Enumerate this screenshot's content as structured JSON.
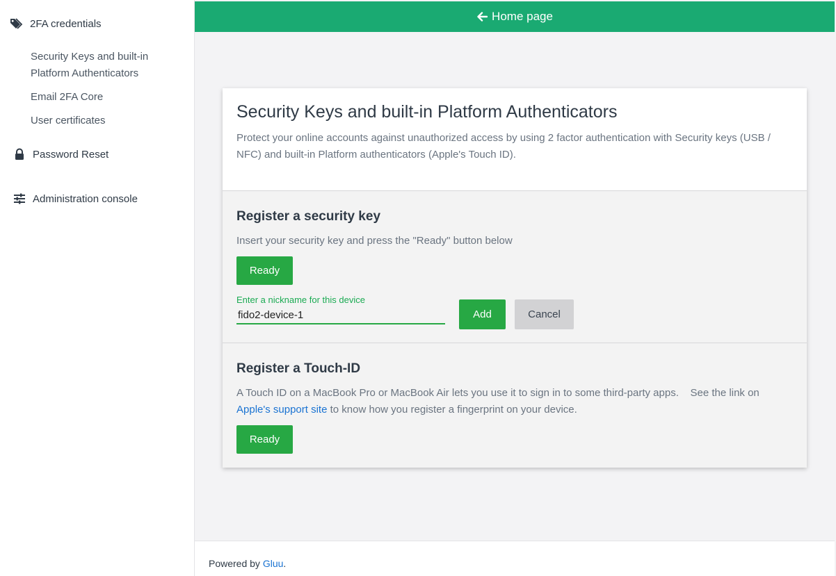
{
  "sidebar": {
    "heading": {
      "label": "2FA credentials",
      "icon": "tags-icon"
    },
    "sub_items": [
      {
        "label_line1": "Security Keys and built-in",
        "label_line2": "Platform Authenticators"
      },
      {
        "label": "Email 2FA Core"
      },
      {
        "label": "User certificates"
      }
    ],
    "links": [
      {
        "label": "Password Reset",
        "icon": "lock-icon"
      },
      {
        "label": "Administration console",
        "icon": "sliders-icon"
      }
    ]
  },
  "topbar": {
    "label": "Home page",
    "icon": "arrow-left-icon",
    "color": "#1aaa72"
  },
  "card": {
    "title": "Security Keys and built-in Platform Authenticators",
    "description": "Protect your online accounts against unauthorized access by using 2 factor authentication with Security keys (USB / NFC) and built-in Platform authenticators (Apple's Touch ID).",
    "security_key": {
      "title": "Register a security key",
      "text": "Insert your security key and press the \"Ready\" button below",
      "ready_label": "Ready",
      "nickname_label": "Enter a nickname for this device",
      "nickname_value": "fido2-device-1",
      "add_label": "Add",
      "cancel_label": "Cancel"
    },
    "touch_id": {
      "title": "Register a Touch-ID",
      "text_before": "A Touch ID on a MacBook Pro or MacBook Air lets you use it to sign in to some third-party apps.    See the link on",
      "link_text": "Apple's support site",
      "text_after": "to know how you register a fingerprint on your device.",
      "ready_label": "Ready"
    }
  },
  "footer": {
    "prefix": "Powered by",
    "link_text": "Gluu",
    "suffix": "."
  },
  "colors": {
    "accent_green": "#27a844",
    "link_blue": "#1a73d2"
  }
}
